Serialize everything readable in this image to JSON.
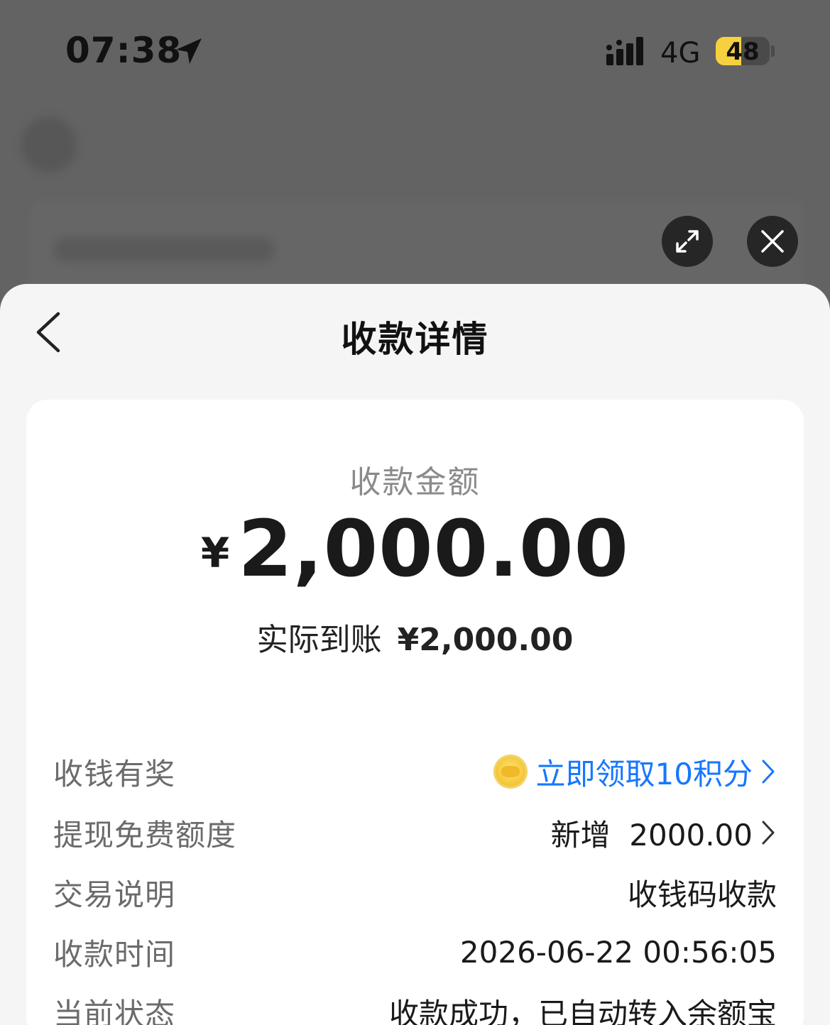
{
  "status_bar": {
    "time": "07:38",
    "network": "4G",
    "battery_level": "48",
    "battery_percent": 48
  },
  "header": {
    "title": "收款详情"
  },
  "amount": {
    "label": "收款金额",
    "currency": "¥",
    "value": "2,000.00",
    "received_label": "实际到账",
    "received_value": "¥2,000.00"
  },
  "details": [
    {
      "label": "收钱有奖",
      "value": "立即领取10积分",
      "link": true,
      "icon": "coin-icon",
      "arrow": true
    },
    {
      "label": "提现免费额度",
      "value": "新增  2000.00",
      "link": false,
      "arrow": true
    },
    {
      "label": "交易说明",
      "value": "收钱码收款",
      "link": false,
      "arrow": false
    },
    {
      "label": "收款时间",
      "value": "2026-06-22 00:56:05",
      "link": false,
      "arrow": false
    },
    {
      "label": "当前状态",
      "value": "收款成功，已自动转入余额宝",
      "link": false,
      "arrow": false
    }
  ],
  "colors": {
    "link": "#1677ff",
    "battery": "#f6d03f",
    "overlay": "#636363",
    "sheet": "#f5f5f5"
  }
}
